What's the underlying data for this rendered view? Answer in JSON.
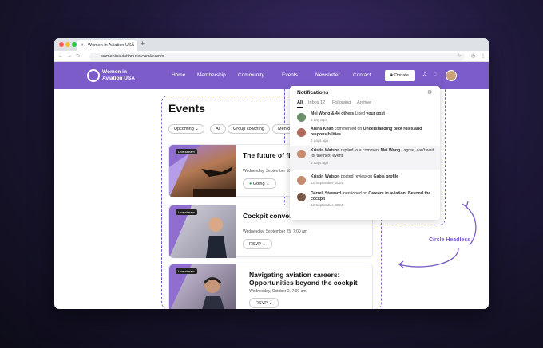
{
  "browser": {
    "tab_title": "Women in Aviation USA",
    "url": "womeninaviationusa.com/events"
  },
  "site": {
    "logo_line1": "Women in",
    "logo_line2": "Aviation USA",
    "menu": [
      "Home",
      "Membership",
      "Community",
      "Events",
      "Newsletter",
      "Contact"
    ],
    "donate": "Donate"
  },
  "page": {
    "heading": "Events",
    "filters": [
      "Upcoming",
      "All",
      "Group coaching",
      "Mentor"
    ]
  },
  "events": [
    {
      "badge": "Live stream",
      "title": "The future of flig… and hybrid aircra…",
      "date": "Wednesday, September 18",
      "button": "Going"
    },
    {
      "badge": "Live stream",
      "title": "Cockpit conversa… with commercial…",
      "date": "Wednesday, September 25, 7:00 am",
      "button": "RSVP"
    },
    {
      "badge": "Live stream",
      "title": "Navigating aviation careers: Opportunities beyond the cockpit",
      "date": "Wednesday, October 2, 7:00 am",
      "button": "RSVP"
    }
  ],
  "notifications": {
    "title": "Notifications",
    "tabs": [
      "All",
      "Inbox 12",
      "Following",
      "Archive"
    ],
    "items": [
      {
        "name": "Mei Wong & 44 others",
        "action": "Liked",
        "target": "your post",
        "time": "a day ago"
      },
      {
        "name": "Aisha Khan",
        "action": "commented on",
        "target": "Understanding pilot roles and responsibilities",
        "time": "2 days ago"
      },
      {
        "name": "Kristin Watson",
        "action": "replied to a comment",
        "target": "Mei Wong",
        "extra": "I agree, can't wait for the next event!",
        "time": "3 days ago"
      },
      {
        "name": "Kristin Watson",
        "action": "posted review on",
        "target": "Gab's profile",
        "time": "12 September, 2024"
      },
      {
        "name": "Darrell Steward",
        "action": "mentioned on",
        "target": "Careers in aviation: Beyond the cockpit",
        "time": "12 September, 2024"
      }
    ]
  },
  "annotation": {
    "label": "Circle Headless"
  },
  "colors": {
    "brand": "#7b5cc8",
    "annotation": "#7b5cc8"
  }
}
